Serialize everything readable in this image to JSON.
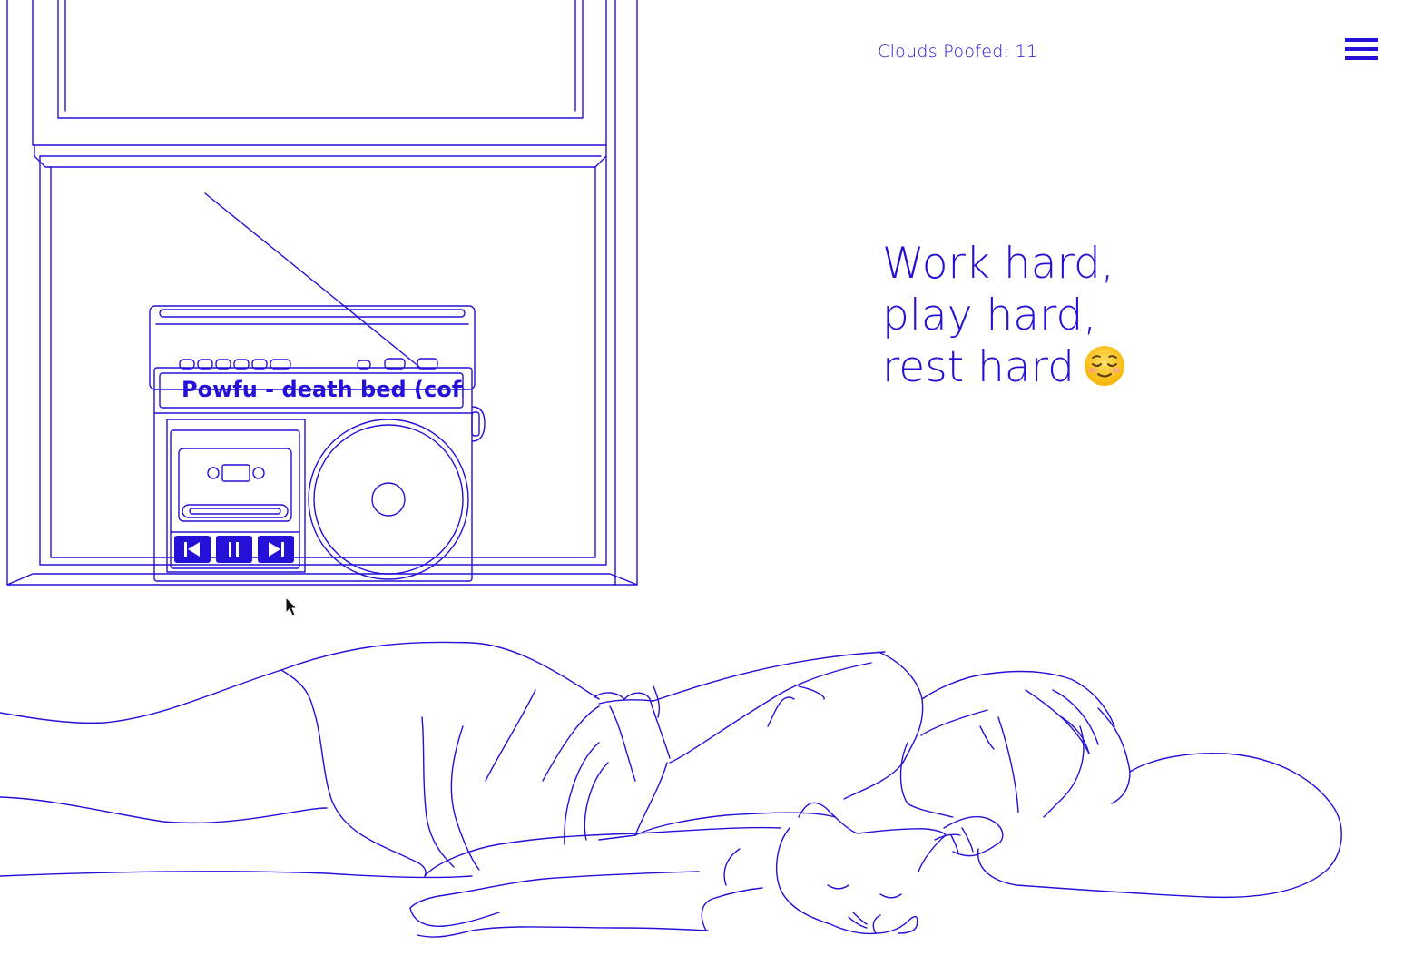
{
  "header": {
    "counter_label": "Clouds Poofed: 11",
    "menu_icon": "hamburger-icon"
  },
  "tagline": {
    "line1": "Work hard,",
    "line2": "play hard,",
    "line3": "rest hard",
    "emoji_icon": "relieved-face-emoji"
  },
  "player": {
    "now_playing": "Powfu - death bed (coffee for your head)",
    "controls": [
      {
        "name": "previous-track-icon"
      },
      {
        "name": "pause-icon"
      },
      {
        "name": "next-track-icon"
      }
    ]
  },
  "colors": {
    "line": "#2410d6",
    "background": "#ffffff"
  }
}
